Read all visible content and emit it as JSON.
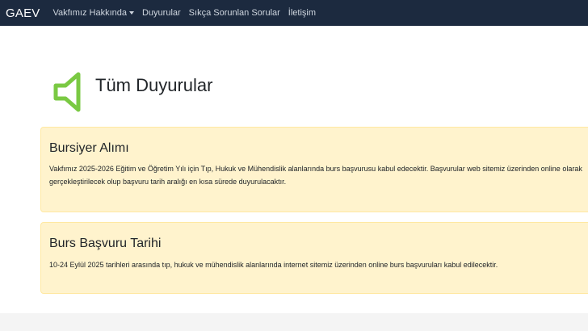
{
  "navbar": {
    "brand": "GAEV",
    "items": [
      {
        "label": "Vakfımız Hakkında",
        "dropdown": true
      },
      {
        "label": "Duyurular"
      },
      {
        "label": "Sıkça Sorunlan Sorular"
      },
      {
        "label": "İletişim"
      }
    ]
  },
  "page": {
    "title": "Tüm Duyurular",
    "icon": "megaphone-icon",
    "icon_color": "#7ac943"
  },
  "announcements": [
    {
      "title": "Bursiyer Alımı",
      "text": "Vakfımız 2025-2026 Eğitim ve Öğretim Yılı için Tıp, Hukuk ve Mühendislik alanlarında burs başvurusu kabul edecektir. Başvurular web sitemiz üzerinden online olarak gerçekleştirilecek olup başvuru tarih aralığı en kısa sürede duyurulacaktır."
    },
    {
      "title": "Burs Başvuru Tarihi",
      "text": "10-24 Eylül 2025 tarihleri arasında tıp, hukuk ve mühendislik alanlarında internet sitemiz üzerinden online burs başvuruları kabul edilecektir."
    }
  ],
  "colors": {
    "navbar_bg": "#1c2a3f",
    "card_bg": "#fff3cd"
  }
}
